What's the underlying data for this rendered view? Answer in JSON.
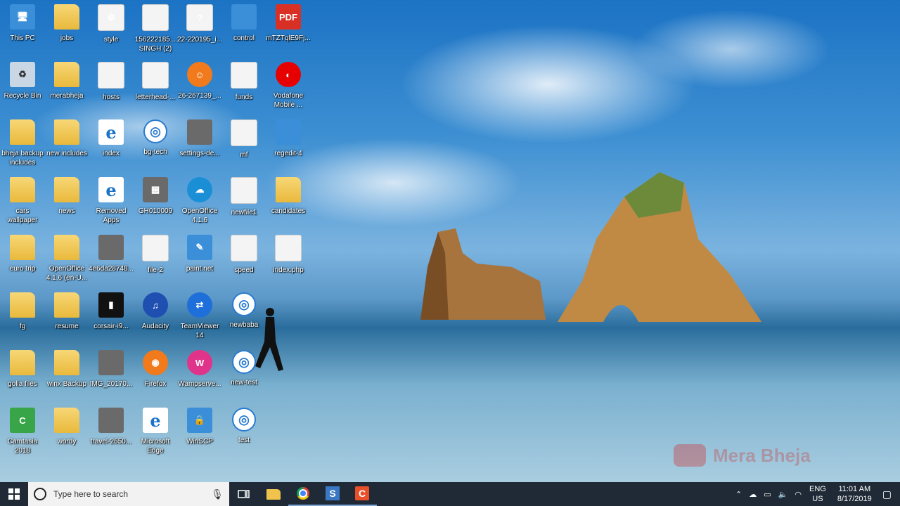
{
  "desktop": {
    "icons": [
      {
        "label": "This PC",
        "kind": "sys",
        "glyph": "🖥",
        "col": 0,
        "row": 0
      },
      {
        "label": "jobs",
        "kind": "folder",
        "glyph": "",
        "col": 1,
        "row": 0
      },
      {
        "label": "style",
        "kind": "doc",
        "glyph": "⚙",
        "col": 2,
        "row": 0
      },
      {
        "label": "156222185... SINGH (2)",
        "kind": "doc",
        "glyph": "",
        "col": 3,
        "row": 0
      },
      {
        "label": "22-220195_i...",
        "kind": "doc",
        "glyph": "?",
        "col": 4,
        "row": 0
      },
      {
        "label": "control",
        "kind": "sys",
        "glyph": "",
        "col": 5,
        "row": 0
      },
      {
        "label": "mTZTqlE9Fj...",
        "kind": "pdf",
        "glyph": "PDF",
        "col": 6,
        "row": 0
      },
      {
        "label": "Recycle Bin",
        "kind": "bin",
        "glyph": "♻",
        "col": 0,
        "row": 1
      },
      {
        "label": "merabheja",
        "kind": "folder",
        "glyph": "",
        "col": 1,
        "row": 1
      },
      {
        "label": "hosts",
        "kind": "doc",
        "glyph": "",
        "col": 2,
        "row": 1
      },
      {
        "label": "letterhead-...",
        "kind": "doc",
        "glyph": "",
        "col": 3,
        "row": 1
      },
      {
        "label": "26-267139_...",
        "kind": "fox",
        "glyph": "☺",
        "col": 4,
        "row": 1
      },
      {
        "label": "funds",
        "kind": "doc",
        "glyph": "",
        "col": 5,
        "row": 1
      },
      {
        "label": "Vodafone Mobile ...",
        "kind": "voda",
        "glyph": "◐",
        "col": 6,
        "row": 1
      },
      {
        "label": "bheja backup includes",
        "kind": "folder",
        "glyph": "",
        "col": 0,
        "row": 2
      },
      {
        "label": "new includes",
        "kind": "folder",
        "glyph": "",
        "col": 1,
        "row": 2
      },
      {
        "label": "index",
        "kind": "ie",
        "glyph": "e",
        "col": 2,
        "row": 2
      },
      {
        "label": "bg-tech",
        "kind": "bg",
        "glyph": "◎",
        "col": 3,
        "row": 2
      },
      {
        "label": "settings-de...",
        "kind": "img",
        "glyph": "",
        "col": 4,
        "row": 2
      },
      {
        "label": "mf",
        "kind": "doc",
        "glyph": "",
        "col": 5,
        "row": 2
      },
      {
        "label": "regedit-4",
        "kind": "sys",
        "glyph": "",
        "col": 6,
        "row": 2
      },
      {
        "label": "cars wallpaper",
        "kind": "folder",
        "glyph": "",
        "col": 0,
        "row": 3
      },
      {
        "label": "news",
        "kind": "folder",
        "glyph": "",
        "col": 1,
        "row": 3
      },
      {
        "label": "Removed Apps",
        "kind": "ie",
        "glyph": "e",
        "col": 2,
        "row": 3
      },
      {
        "label": "GH010009",
        "kind": "img",
        "glyph": "▦",
        "col": 3,
        "row": 3
      },
      {
        "label": "OpenOffice 4.1.6",
        "kind": "oo",
        "glyph": "☁",
        "col": 4,
        "row": 3
      },
      {
        "label": "newfile1",
        "kind": "doc",
        "glyph": "",
        "col": 5,
        "row": 3
      },
      {
        "label": "candidates",
        "kind": "folder",
        "glyph": "",
        "col": 6,
        "row": 3
      },
      {
        "label": "euro trip",
        "kind": "folder",
        "glyph": "",
        "col": 0,
        "row": 4
      },
      {
        "label": "OpenOffice 4.1.6 (en-U...",
        "kind": "folder",
        "glyph": "",
        "col": 1,
        "row": 4
      },
      {
        "label": "4e6da28748...",
        "kind": "img",
        "glyph": "",
        "col": 2,
        "row": 4
      },
      {
        "label": "file-2",
        "kind": "doc",
        "glyph": "",
        "col": 3,
        "row": 4
      },
      {
        "label": "paint.net",
        "kind": "sys",
        "glyph": "✎",
        "col": 4,
        "row": 4
      },
      {
        "label": "speed",
        "kind": "doc",
        "glyph": "",
        "col": 5,
        "row": 4
      },
      {
        "label": "index.php",
        "kind": "doc",
        "glyph": "",
        "col": 6,
        "row": 4
      },
      {
        "label": "fg",
        "kind": "folder",
        "glyph": "",
        "col": 0,
        "row": 5
      },
      {
        "label": "resume",
        "kind": "folder",
        "glyph": "",
        "col": 1,
        "row": 5
      },
      {
        "label": "corsair-i9...",
        "kind": "phone",
        "glyph": "▮",
        "col": 2,
        "row": 5
      },
      {
        "label": "Audacity",
        "kind": "aud",
        "glyph": "♫",
        "col": 3,
        "row": 5
      },
      {
        "label": "TeamViewer 14",
        "kind": "tv",
        "glyph": "⇄",
        "col": 4,
        "row": 5
      },
      {
        "label": "newbaba",
        "kind": "bg",
        "glyph": "◎",
        "col": 5,
        "row": 5
      },
      {
        "label": "golia files",
        "kind": "folder",
        "glyph": "",
        "col": 0,
        "row": 6
      },
      {
        "label": "winx Backup",
        "kind": "folder",
        "glyph": "",
        "col": 1,
        "row": 6
      },
      {
        "label": "IMG_20170...",
        "kind": "img",
        "glyph": "",
        "col": 2,
        "row": 6
      },
      {
        "label": "Firefox",
        "kind": "fox",
        "glyph": "◉",
        "col": 3,
        "row": 6
      },
      {
        "label": "Wampserve...",
        "kind": "wamp",
        "glyph": "W",
        "col": 4,
        "row": 6
      },
      {
        "label": "new-test",
        "kind": "bg",
        "glyph": "◎",
        "col": 5,
        "row": 6
      },
      {
        "label": "Camtasia 2018",
        "kind": "cam",
        "glyph": "C",
        "col": 0,
        "row": 7
      },
      {
        "label": "wordy",
        "kind": "folder",
        "glyph": "",
        "col": 1,
        "row": 7
      },
      {
        "label": "travel-2650...",
        "kind": "img",
        "glyph": "",
        "col": 2,
        "row": 7
      },
      {
        "label": "Microsoft Edge",
        "kind": "ie",
        "glyph": "e",
        "col": 3,
        "row": 7
      },
      {
        "label": "WinSCP",
        "kind": "sys",
        "glyph": "🔒",
        "col": 4,
        "row": 7
      },
      {
        "label": "test",
        "kind": "bg",
        "glyph": "◎",
        "col": 5,
        "row": 7
      }
    ],
    "watermark": "Mera Bheja"
  },
  "taskbar": {
    "search_placeholder": "Type here to search",
    "tray": {
      "language_top": "ENG",
      "language_bottom": "US",
      "time": "11:01 AM",
      "date": "8/17/2019"
    }
  },
  "colors": {
    "taskbar_bg": "#1f2a36",
    "accent": "#7aa7d6"
  }
}
